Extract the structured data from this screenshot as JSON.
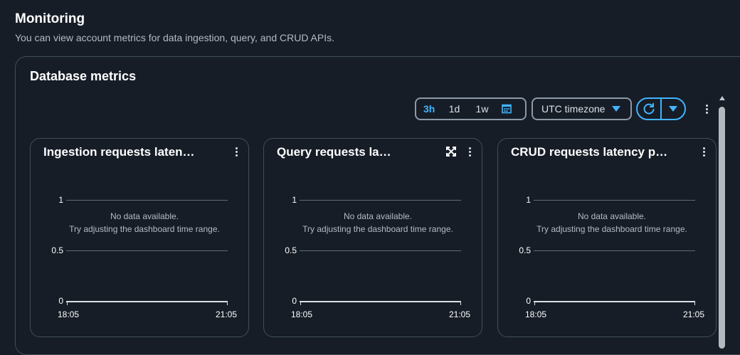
{
  "page": {
    "title": "Monitoring",
    "description": "You can view account metrics for data ingestion, query, and CRUD APIs."
  },
  "container": {
    "title": "Database metrics"
  },
  "toolbar": {
    "ranges": [
      "3h",
      "1d",
      "1w"
    ],
    "active_range": "3h",
    "timezone": "UTC timezone",
    "accent_color": "#42b4ff"
  },
  "widgets": [
    {
      "title": "Ingestion requests laten…",
      "no_data": "No data available.",
      "hint": "Try adjusting the dashboard time range.",
      "y_ticks": [
        "1",
        "0.5",
        "0"
      ],
      "x_ticks": [
        "18:05",
        "21:05"
      ]
    },
    {
      "title": "Query requests la…",
      "no_data": "No data available.",
      "hint": "Try adjusting the dashboard time range.",
      "y_ticks": [
        "1",
        "0.5",
        "0"
      ],
      "x_ticks": [
        "18:05",
        "21:05"
      ]
    },
    {
      "title": "CRUD requests latency p…",
      "no_data": "No data available.",
      "hint": "Try adjusting the dashboard time range.",
      "y_ticks": [
        "1",
        "0.5",
        "0"
      ],
      "x_ticks": [
        "18:05",
        "21:05"
      ]
    }
  ]
}
